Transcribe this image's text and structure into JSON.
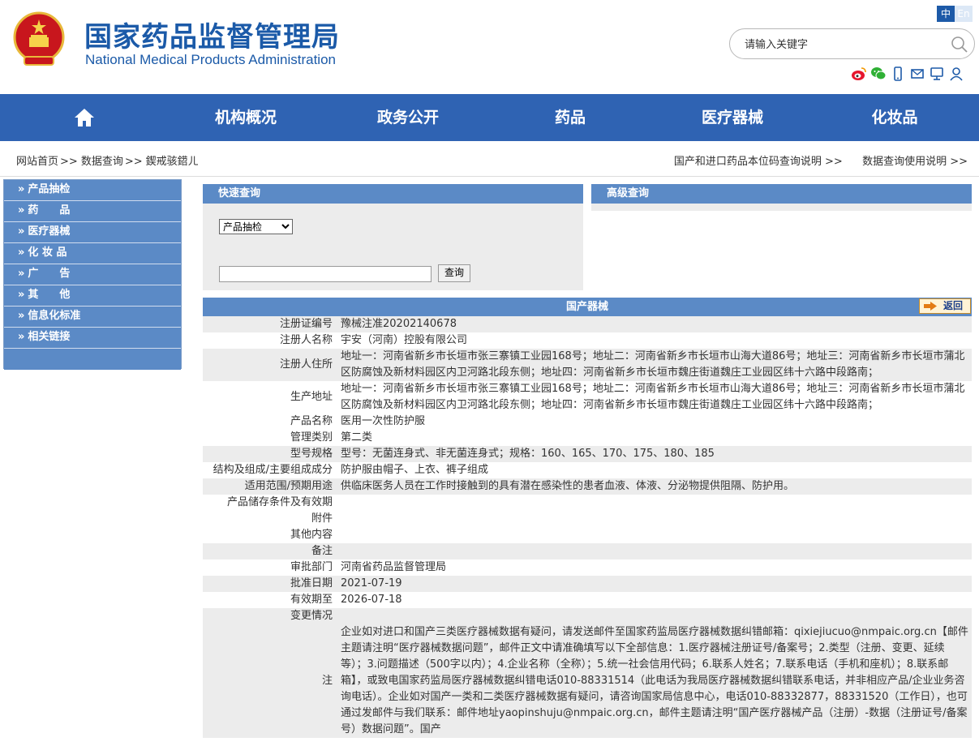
{
  "header": {
    "title_cn": "国家药品监督管理局",
    "title_en": "National Medical Products Administration",
    "lang_zh": "中",
    "lang_en": "En",
    "search_placeholder": "请输入关键字",
    "icons": [
      "weibo-icon",
      "wechat-icon",
      "mobile-icon",
      "mail-icon",
      "consult-icon",
      "user-icon"
    ]
  },
  "nav": {
    "items": [
      "机构概况",
      "政务公开",
      "药品",
      "医疗器械",
      "化妆品"
    ]
  },
  "breadcrumb": {
    "home": "网站首页",
    "sep": ">>",
    "query": "数据查询",
    "current": "鍥戒骇鍣ㄦ",
    "link1": "国产和进口药品本位码查询说明 >>",
    "link2": "数据查询使用说明 >>"
  },
  "sidebar": {
    "items": [
      "产品抽检",
      "药　　品",
      "医疗器械",
      "化 妆 品",
      "广　　告",
      "其　　他",
      "信息化标准",
      "相关链接"
    ]
  },
  "quick_search": {
    "title": "快速查询",
    "selected": "产品抽检",
    "button": "查询"
  },
  "advanced_search": {
    "title": "高级查询"
  },
  "detail": {
    "title": "国产器械",
    "back_label": "返回",
    "rows": [
      {
        "k": "注册证编号",
        "v": "豫械注准20202140678"
      },
      {
        "k": "注册人名称",
        "v": "宇安（河南）控股有限公司"
      },
      {
        "k": "注册人住所",
        "v": "地址一：河南省新乡市长垣市张三寨镇工业园168号；地址二：河南省新乡市长垣市山海大道86号；地址三：河南省新乡市长垣市蒲北区防腐蚀及新材料园区内卫河路北段东侧；地址四：河南省新乡市长垣市魏庄街道魏庄工业园区纬十六路中段路南；"
      },
      {
        "k": "生产地址",
        "v": "地址一：河南省新乡市长垣市张三寨镇工业园168号；地址二：河南省新乡市长垣市山海大道86号；地址三：河南省新乡市长垣市蒲北区防腐蚀及新材料园区内卫河路北段东侧；地址四：河南省新乡市长垣市魏庄街道魏庄工业园区纬十六路中段路南；"
      },
      {
        "k": "产品名称",
        "v": "医用一次性防护服"
      },
      {
        "k": "管理类别",
        "v": "第二类"
      },
      {
        "k": "型号规格",
        "v": "型号：无菌连身式、非无菌连身式；规格：160、165、170、175、180、185"
      },
      {
        "k": "结构及组成/主要组成成分",
        "v": "防护服由帽子、上衣、裤子组成"
      },
      {
        "k": "适用范围/预期用途",
        "v": "供临床医务人员在工作时接触到的具有潜在感染性的患者血液、体液、分泌物提供阻隔、防护用。"
      },
      {
        "k": "产品储存条件及有效期",
        "v": ""
      },
      {
        "k": "附件",
        "v": ""
      },
      {
        "k": "其他内容",
        "v": ""
      },
      {
        "k": "备注",
        "v": ""
      },
      {
        "k": "审批部门",
        "v": "河南省药品监督管理局"
      },
      {
        "k": "批准日期",
        "v": "2021-07-19"
      },
      {
        "k": "有效期至",
        "v": "2026-07-18"
      },
      {
        "k": "变更情况",
        "v": ""
      },
      {
        "k": "注",
        "v": "企业如对进口和国产三类医疗器械数据有疑问，请发送邮件至国家药监局医疗器械数据纠错邮箱：qixiejiucuo@nmpaic.org.cn【邮件主题请注明“医疗器械数据问题”，邮件正文中请准确填写以下全部信息：1.医疗器械注册证号/备案号；2.类型（注册、变更、延续等）；3.问题描述（500字以内）；4.企业名称（全称）；5.统一社会信用代码；6.联系人姓名；7.联系电话（手机和座机）；8.联系邮箱】，或致电国家药监局医疗器械数据纠错电话010-88331514（此电话为我局医疗器械数据纠错联系电话，并非相应产品/企业业务咨询电话）。企业如对国产一类和二类医疗器械数据有疑问，请咨询国家局信息中心，电话010-88332877，88331520（工作日），也可通过发邮件与我们联系：邮件地址yaopinshuju@nmpaic.org.cn，邮件主题请注明“国产医疗器械产品（注册）-数据（注册证号/备案号）数据问题”。国产"
      }
    ]
  }
}
